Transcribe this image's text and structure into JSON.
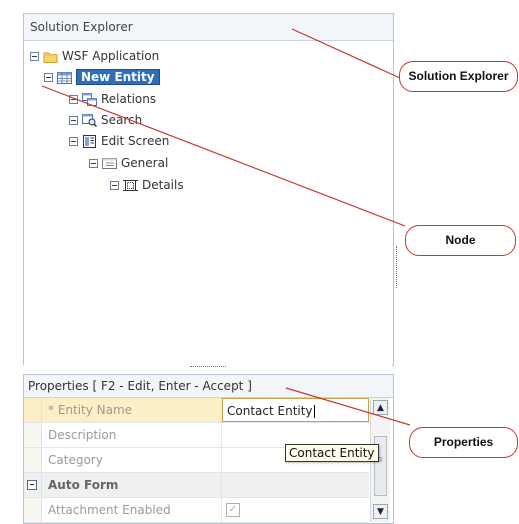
{
  "solution_explorer": {
    "title": "Solution Explorer",
    "tree": [
      {
        "label": "WSF Application",
        "icon": "folder-icon"
      },
      {
        "label": "New Entity",
        "icon": "grid-icon",
        "selected": true
      },
      {
        "label": "Relations",
        "icon": "relations-icon"
      },
      {
        "label": "Search",
        "icon": "search-icon"
      },
      {
        "label": "Edit Screen",
        "icon": "edit-screen-icon"
      },
      {
        "label": "General",
        "icon": "form-icon"
      },
      {
        "label": "Details",
        "icon": "details-icon"
      }
    ]
  },
  "properties": {
    "title": "Properties [ F2 - Edit, Enter - Accept ]",
    "rows": [
      {
        "name": "* Entity Name",
        "value": "Contact Entity"
      },
      {
        "name": "Description",
        "value": ""
      },
      {
        "name": "Category",
        "value": ""
      },
      {
        "name": "Auto Form",
        "value": "",
        "group": true
      },
      {
        "name": "Attachment Enabled",
        "checked": true
      }
    ],
    "tooltip": "Contact Entity"
  },
  "callouts": {
    "solution_explorer": "Solution Explorer",
    "node": "Node",
    "properties": "Properties"
  },
  "colors": {
    "annotation_line": "#c23a2f",
    "selection": "#2f6fba",
    "edit_row": "#fbefc6"
  }
}
